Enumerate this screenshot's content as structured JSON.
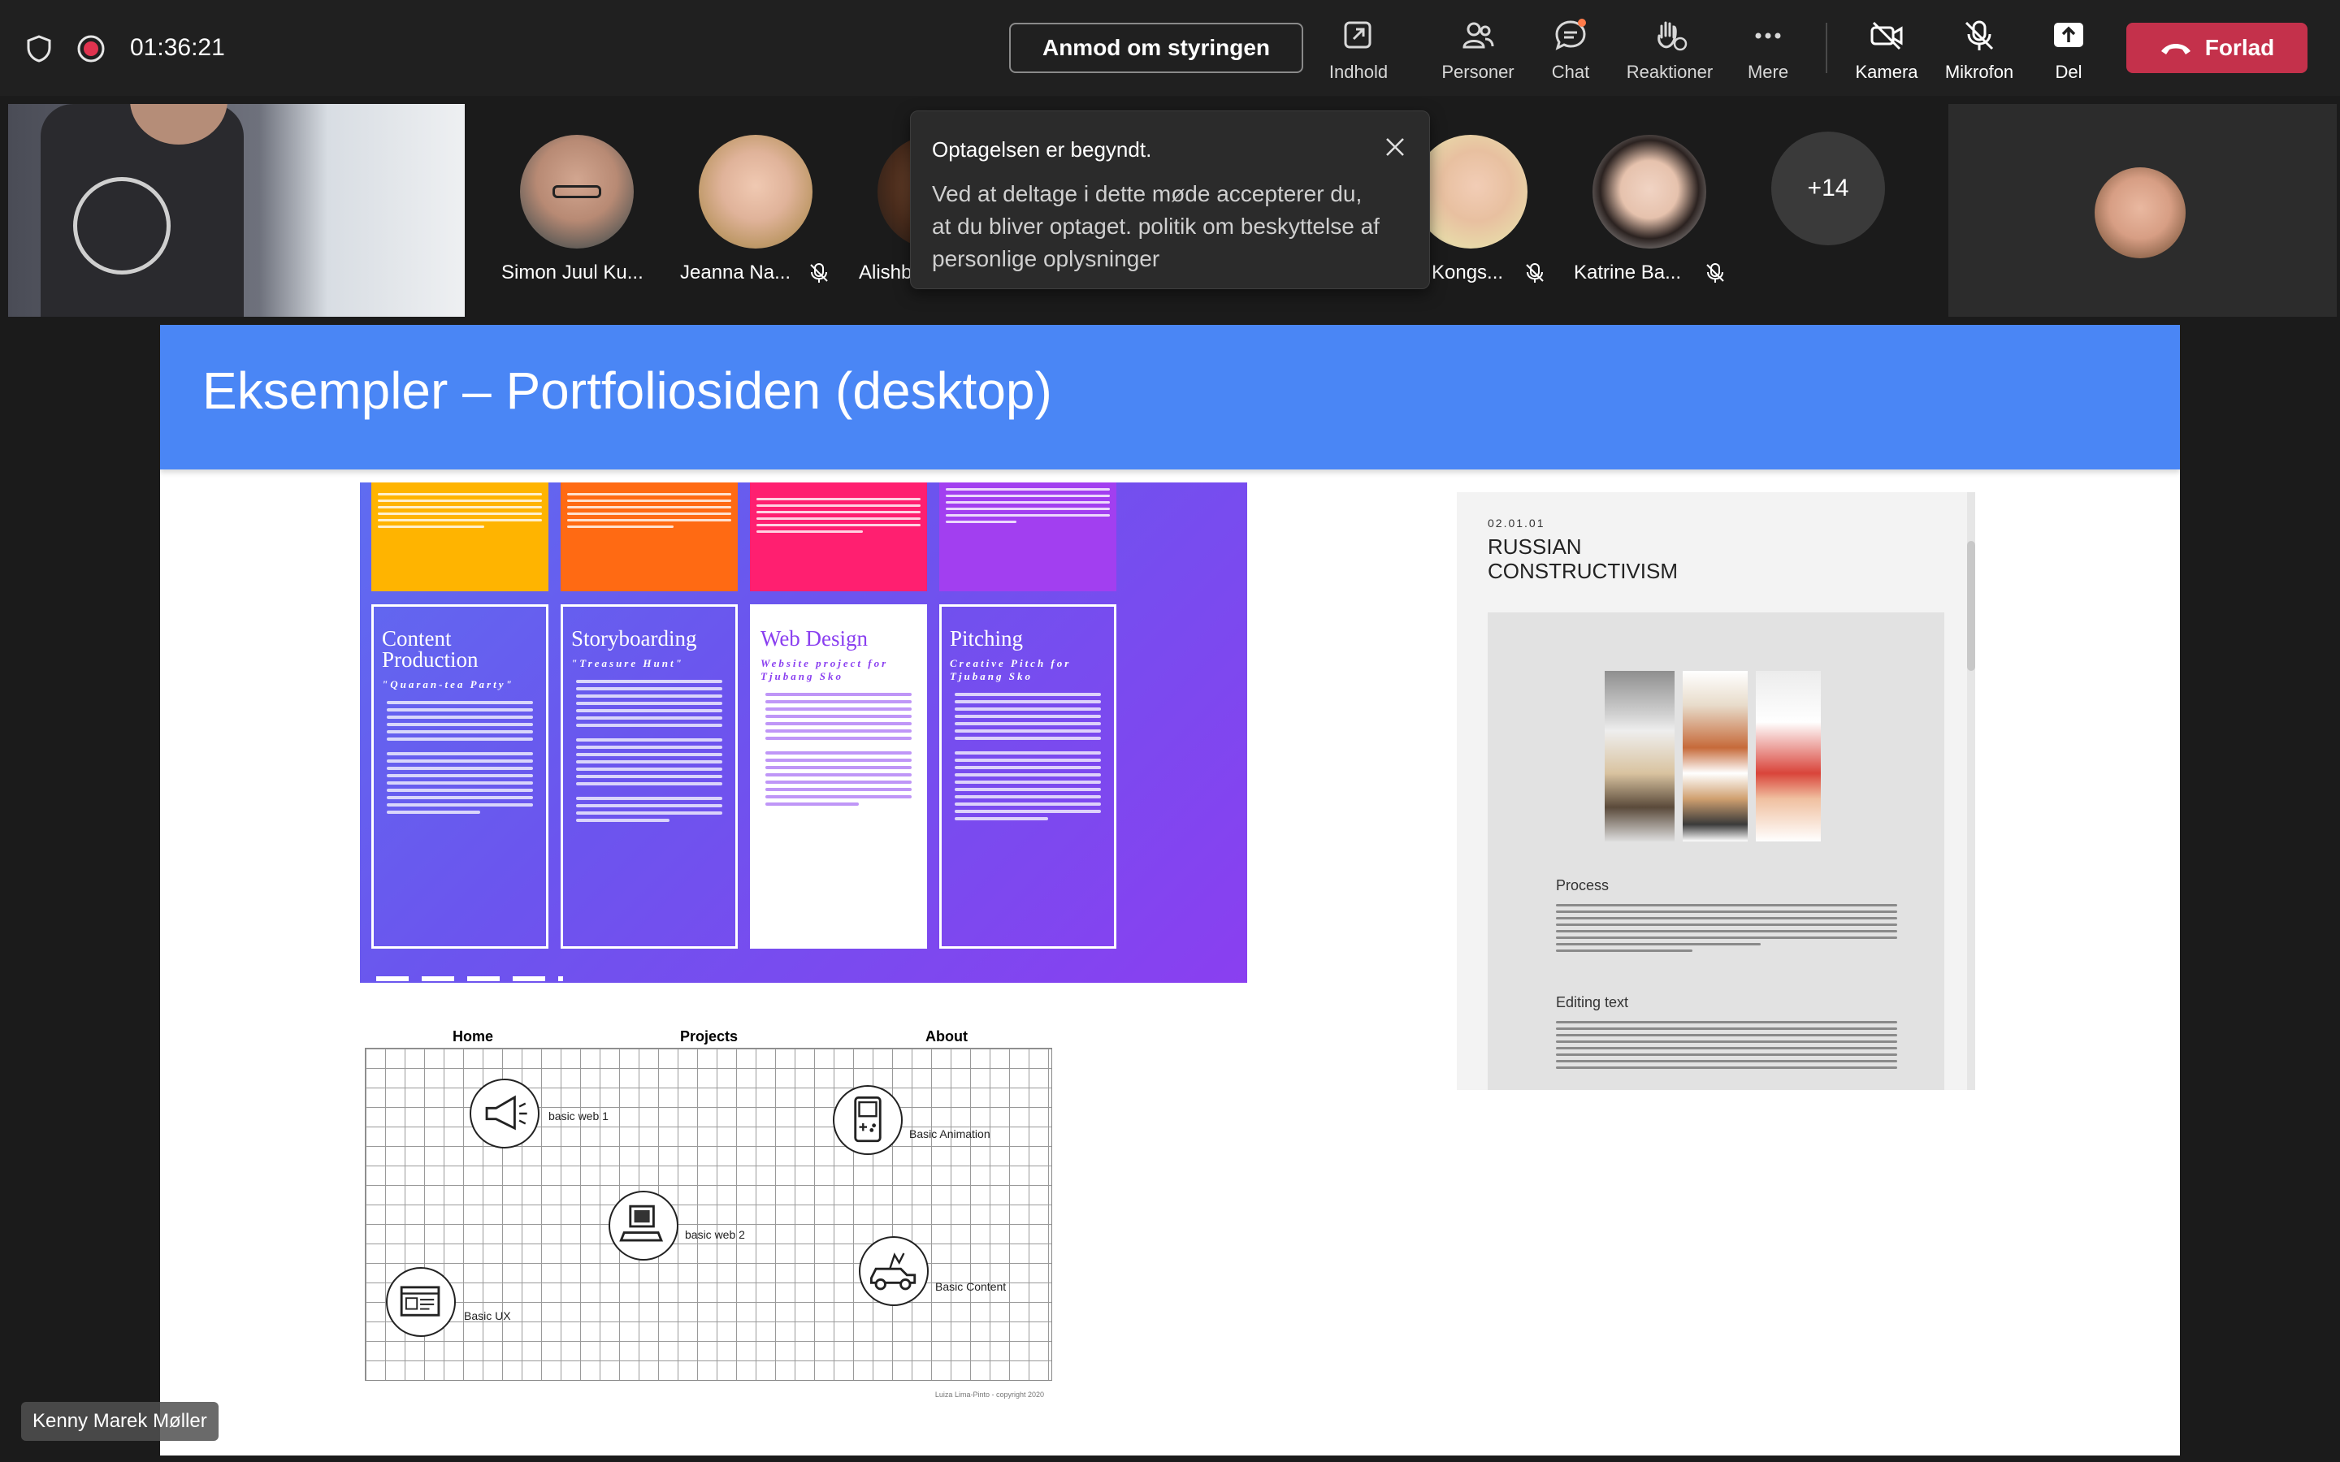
{
  "window": {
    "timer": "01:36:21"
  },
  "toolbar": {
    "request_control_label": "Anmod om styringen",
    "buttons": [
      {
        "label": "Indhold",
        "icon": "share-content-icon"
      },
      {
        "label": "Personer",
        "icon": "people-icon"
      },
      {
        "label": "Chat",
        "icon": "chat-icon"
      },
      {
        "label": "Reaktioner",
        "icon": "reactions-icon"
      },
      {
        "label": "Mere",
        "icon": "more-icon"
      },
      {
        "label": "Kamera",
        "icon": "camera-off-icon"
      },
      {
        "label": "Mikrofon",
        "icon": "mic-off-icon"
      },
      {
        "label": "Del",
        "icon": "share-icon"
      }
    ],
    "leave_label": "Forlad",
    "leave_color": "#c4314b"
  },
  "participants": [
    {
      "name": "Simon Juul Ku...",
      "muted": false
    },
    {
      "name": "Jeanna Na...",
      "muted": true
    },
    {
      "name": "Alishb",
      "muted": false
    },
    {
      "name": "Kongs...",
      "muted": true
    },
    {
      "name": "Katrine Ba...",
      "muted": true
    }
  ],
  "overflow_count": "+14",
  "toast": {
    "title": "Optagelsen er begyndt.",
    "body": "Ved at deltage i dette møde accepterer du, at du bliver optaget. politik om beskyttelse af personlige oplysninger"
  },
  "slide": {
    "title": "Eksempler – Portfoliosiden (desktop)",
    "header_color": "#4a86f5",
    "cards": [
      {
        "title": "Content Production",
        "subtitle": "\"Quaran-tea Party\"",
        "top_color": "#ffb400"
      },
      {
        "title": "Storyboarding",
        "subtitle": "\"Treasure Hunt\"",
        "top_color": "#ff6a13"
      },
      {
        "title": "Web Design",
        "subtitle": "Website project for Tjubang Sko",
        "top_color": "#ff1f70"
      },
      {
        "title": "Pitching",
        "subtitle": "Creative Pitch for Tjubang Sko",
        "top_color": "#a23ff0"
      }
    ],
    "russian": {
      "date": "02.01.01",
      "title": "RUSSIAN CONSTRUCTIVISM",
      "process_heading": "Process",
      "process_text": "This was my first time ever coding a website from scratch. It was a challenge learning the different markups. Brackets and Adobe XD that I also used in this project was very new to me. With alot of trial and error I managed to create a one page website with basic html and css. Adobe XD was used to plan out the layout and design of my content. I edited my pictures on Lightroom an for some of the elements like the header and headings I used Photoshop.",
      "editing_heading": "Editing text",
      "editing_text": "When editing text I start by skimming it through. It helps me getting a sense of what the subject is about. I then start dividing the text up in smaller paragraphs, combining what goes together. Next step is to start structuring up the paragraphs, what order I want them to come in. When it comes to structuring a subject of this matter I like to start broad and then narrow it down. So for this instance my opening paragraph is about what Russian Constructivism is, then going into how the artform is defined and how you"
    },
    "sitemap": {
      "nav": [
        "Home",
        "Projects",
        "About"
      ],
      "nodes": [
        {
          "label": "basic web 1",
          "icon": "megaphone-icon"
        },
        {
          "label": "Basic Animation",
          "icon": "gameboy-icon"
        },
        {
          "label": "basic web 2",
          "icon": "computer-icon"
        },
        {
          "label": "Basic Content",
          "icon": "car-icon"
        },
        {
          "label": "Basic UX",
          "icon": "wireframe-icon"
        }
      ],
      "copyright": "Luiza Lima-Pinto - copyright 2020"
    }
  },
  "presenter": {
    "name": "Kenny Marek Møller"
  }
}
